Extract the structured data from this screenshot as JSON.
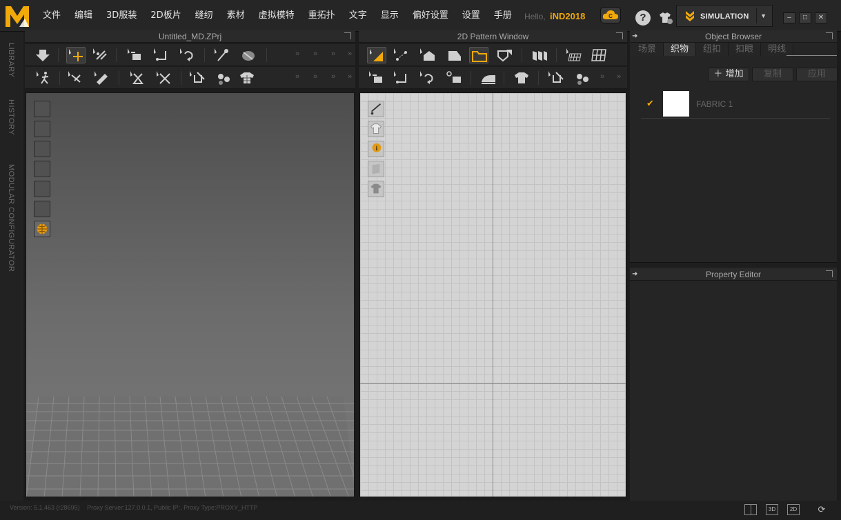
{
  "menubar": {
    "items": [
      "文件",
      "编辑",
      "3D服装",
      "2D板片",
      "缝纫",
      "素材",
      "虚拟模特",
      "重拓扑",
      "文字",
      "显示",
      "偏好设置",
      "设置",
      "手册"
    ],
    "hello_prefix": "Hello,",
    "username": "iND2018",
    "simulation_label": "SIMULATION"
  },
  "left_strip": {
    "tabs": [
      "LIBRARY",
      "HISTORY",
      "MODULAR CONFIGURATOR"
    ]
  },
  "window3d": {
    "title": "Untitled_MD.ZPrj"
  },
  "window2d": {
    "title": "2D Pattern Window"
  },
  "object_browser": {
    "title": "Object Browser",
    "tabs": [
      "场景",
      "织物",
      "纽扣",
      "扣眼",
      "明线"
    ],
    "active_tab": 1,
    "buttons": {
      "add": "增加",
      "copy": "复制",
      "apply": "应用"
    },
    "fabrics": [
      {
        "name": "FABRIC 1",
        "color": "#ffffff",
        "checked": true
      }
    ]
  },
  "property_editor": {
    "title": "Property Editor"
  },
  "statusbar": {
    "version": "Version: 5.1.463 (r28695)",
    "proxy": "Proxy Server:127.0.0.1, Public IP:, Proxy Type:PROXY_HTTP",
    "view_3d": "3D",
    "view_2d": "2D"
  },
  "colors": {
    "accent": "#f2a90a",
    "panel": "#262626",
    "grid2d": "#d4d4d4"
  }
}
